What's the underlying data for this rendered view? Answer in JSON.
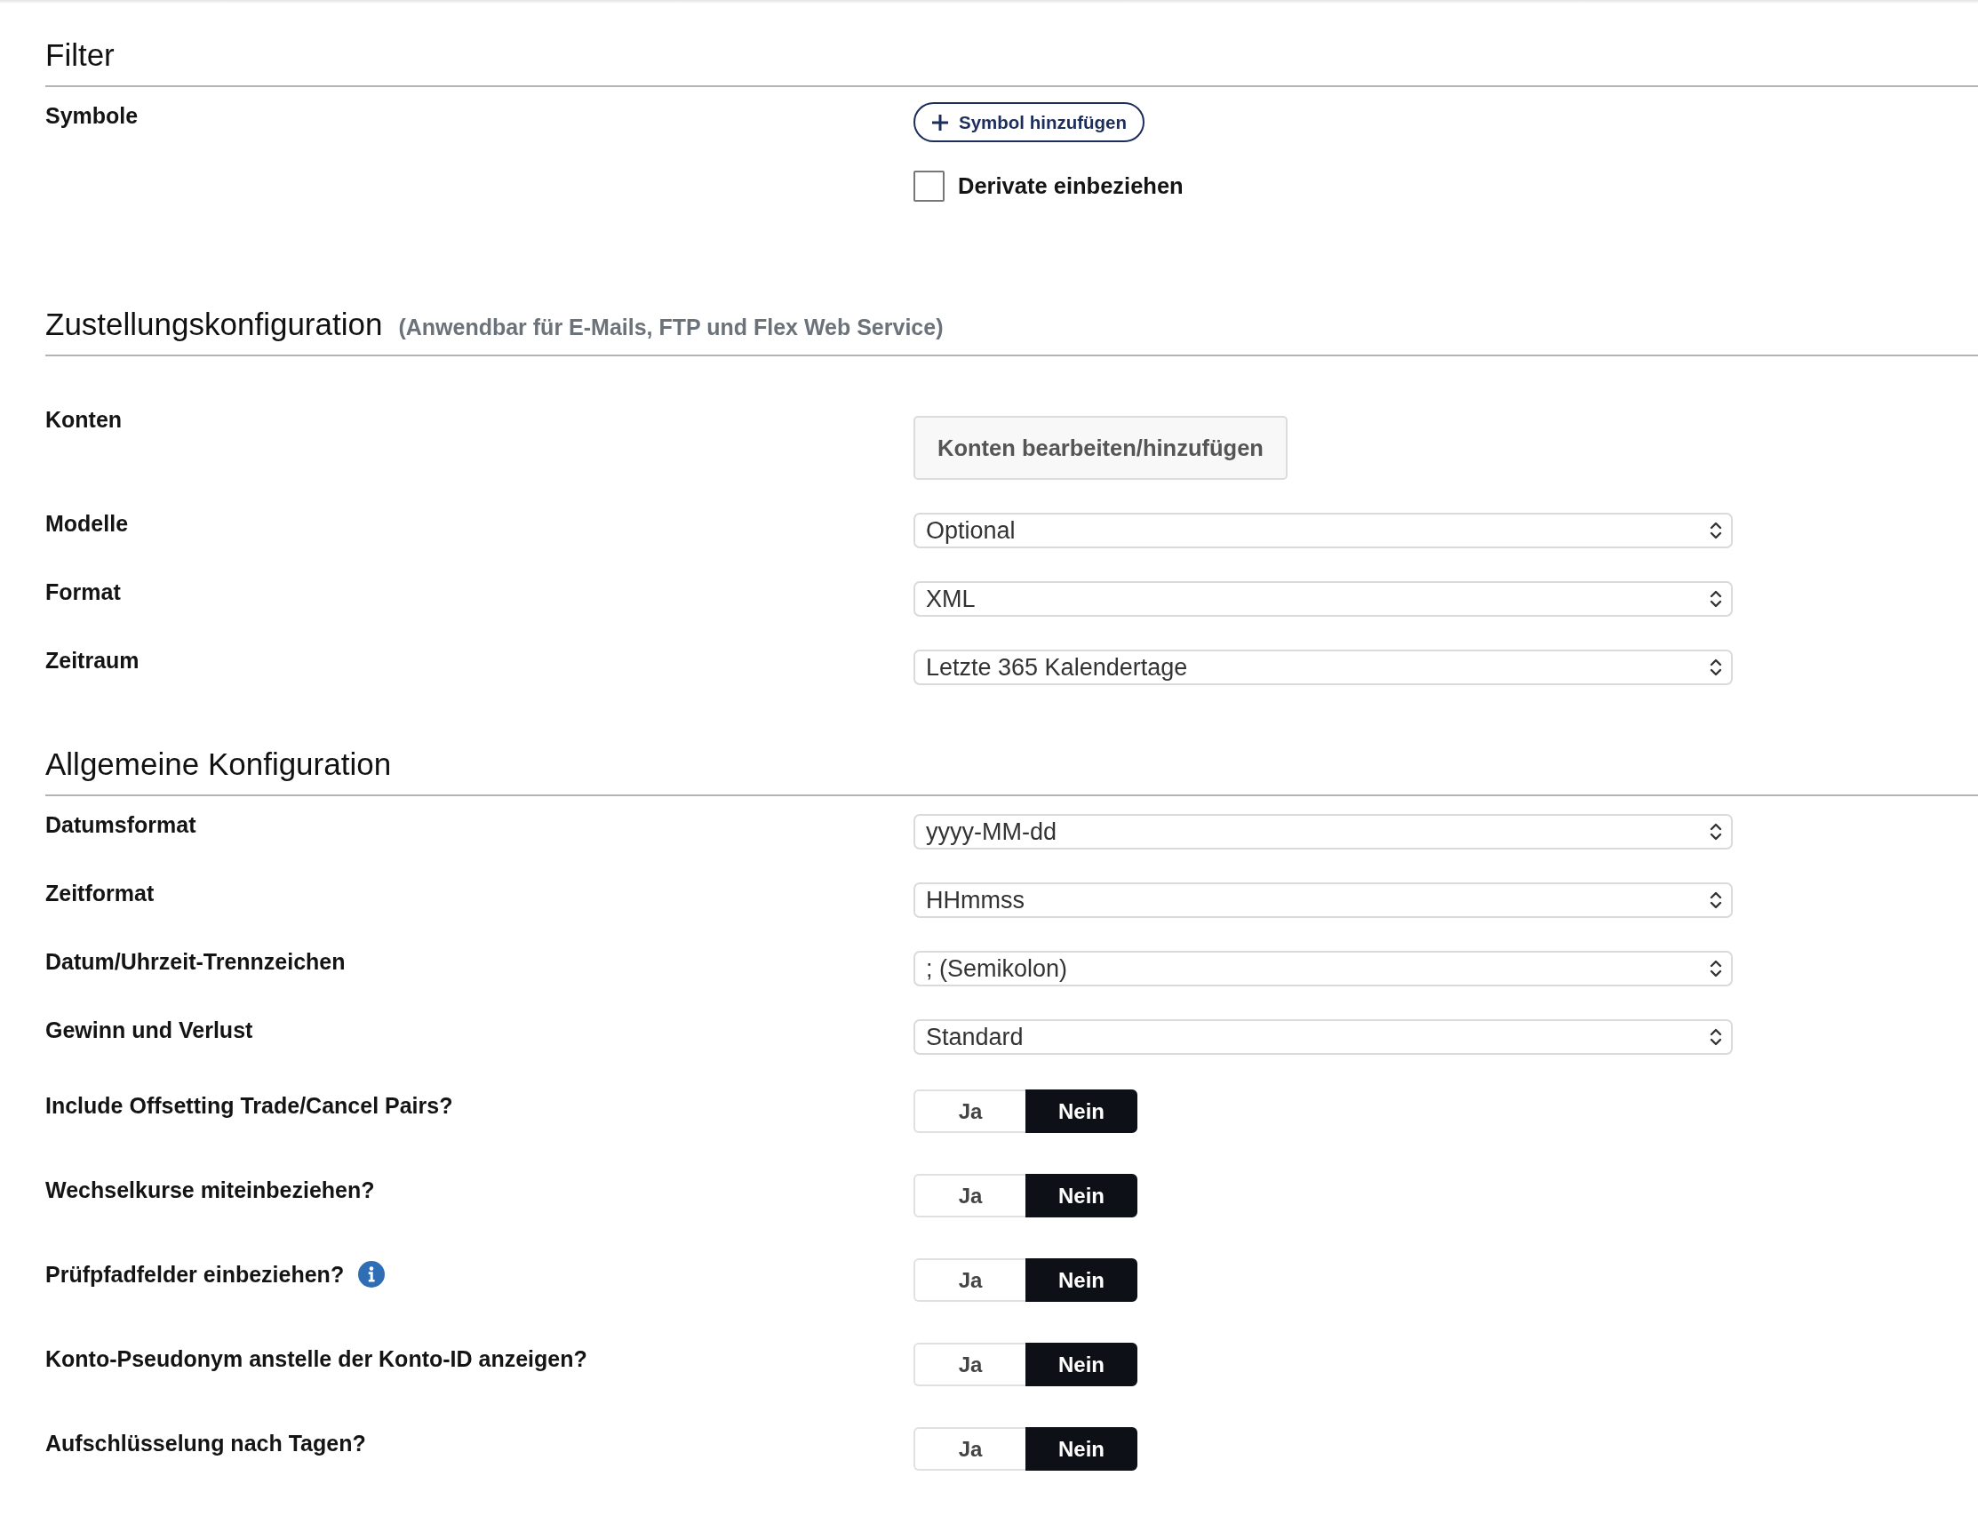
{
  "sections": [
    {
      "title": "Filter",
      "rows": [
        {
          "kind": "add_button",
          "label": "Symbole",
          "button": "Symbol hinzufügen",
          "checkbox": {
            "label": "Derivate einbeziehen",
            "checked": false
          }
        }
      ]
    },
    {
      "title": "Zustellungskonfiguration",
      "subtitle": "(Anwendbar für E-Mails, FTP und Flex Web Service)",
      "rows": [
        {
          "kind": "button",
          "label": "Konten",
          "button": "Konten bearbeiten/hinzufügen"
        },
        {
          "kind": "select",
          "label": "Modelle",
          "value": "Optional"
        },
        {
          "kind": "select",
          "label": "Format",
          "value": "XML"
        },
        {
          "kind": "select",
          "label": "Zeitraum",
          "value": "Letzte 365 Kalendertage"
        }
      ]
    },
    {
      "title": "Allgemeine Konfiguration",
      "rows": [
        {
          "kind": "select",
          "label": "Datumsformat",
          "value": "yyyy-MM-dd"
        },
        {
          "kind": "select",
          "label": "Zeitformat",
          "value": "HHmmss"
        },
        {
          "kind": "select",
          "label": "Datum/Uhrzeit-Trennzeichen",
          "value": "; (Semikolon)"
        },
        {
          "kind": "select",
          "label": "Gewinn und Verlust",
          "value": "Standard"
        },
        {
          "kind": "toggle",
          "label": "Include Offsetting Trade/Cancel Pairs?",
          "info": false,
          "options": [
            {
              "label": "Ja",
              "selected": false
            },
            {
              "label": "Nein",
              "selected": true
            }
          ]
        },
        {
          "kind": "toggle",
          "label": "Wechselkurse miteinbeziehen?",
          "info": false,
          "options": [
            {
              "label": "Ja",
              "selected": false
            },
            {
              "label": "Nein",
              "selected": true
            }
          ]
        },
        {
          "kind": "toggle",
          "label": "Prüfpfadfelder einbeziehen?",
          "info": true,
          "options": [
            {
              "label": "Ja",
              "selected": false
            },
            {
              "label": "Nein",
              "selected": true
            }
          ]
        },
        {
          "kind": "toggle",
          "label": "Konto-Pseudonym anstelle der Konto-ID anzeigen?",
          "info": false,
          "options": [
            {
              "label": "Ja",
              "selected": false
            },
            {
              "label": "Nein",
              "selected": true
            }
          ]
        },
        {
          "kind": "toggle",
          "label": "Aufschlüsselung nach Tagen?",
          "info": false,
          "options": [
            {
              "label": "Ja",
              "selected": false
            },
            {
              "label": "Nein",
              "selected": true
            }
          ]
        }
      ]
    }
  ]
}
